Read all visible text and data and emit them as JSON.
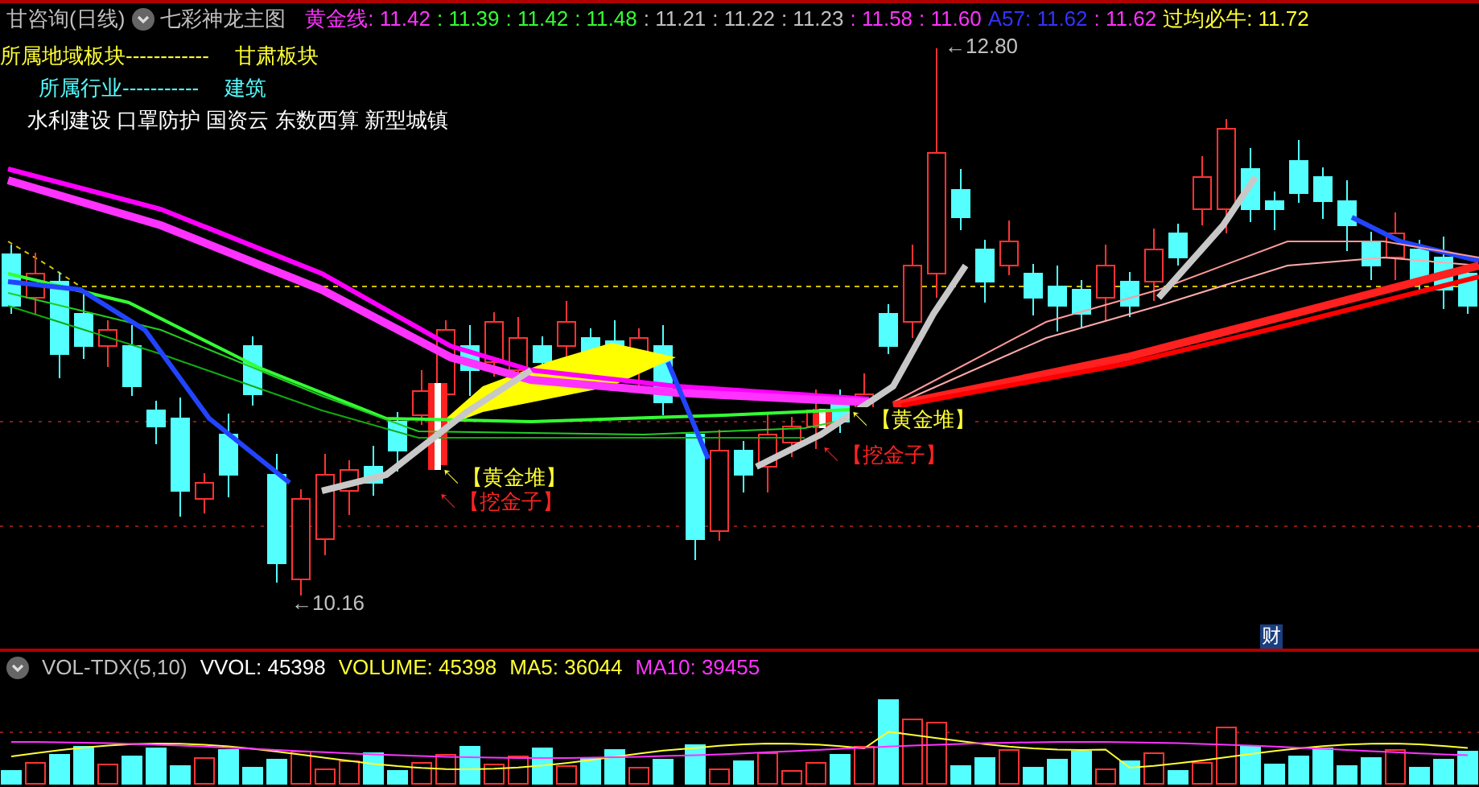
{
  "title": "甘咨询(日线)",
  "indicator": "七彩神龙主图",
  "legend": [
    {
      "text": "黄金线: 11.42",
      "color": "#ff33ff"
    },
    {
      "text": ": 11.39",
      "color": "#33ff33"
    },
    {
      "text": ": 11.42",
      "color": "#33ff33"
    },
    {
      "text": ": 11.48",
      "color": "#33ff33"
    },
    {
      "text": ": 11.21",
      "color": "#c0c0c0"
    },
    {
      "text": ": 11.22",
      "color": "#c0c0c0"
    },
    {
      "text": ": 11.23",
      "color": "#c0c0c0"
    },
    {
      "text": ": 11.58",
      "color": "#ff33ff"
    },
    {
      "text": ": 11.60",
      "color": "#ff33ff"
    },
    {
      "text": "A57: 11.62",
      "color": "#3333ff"
    },
    {
      "text": ": 11.62",
      "color": "#ff33ff"
    },
    {
      "text": "过均必牛: 11.72",
      "color": "#ffff33"
    }
  ],
  "sector": {
    "label": "所属地域板块------------",
    "value": "甘肃板块"
  },
  "industry": {
    "label": "所属行业-----------",
    "value": "建筑"
  },
  "concepts": "水利建设 口罩防护 国资云 东数西算 新型城镇",
  "price_marks": [
    {
      "text": "←12.80",
      "kind": "high"
    },
    {
      "text": "←10.16",
      "kind": "low"
    }
  ],
  "annotations": [
    {
      "text": "↖【黄金堆】",
      "kind": "gold"
    },
    {
      "text": "↖【挖金子】",
      "kind": "dig"
    },
    {
      "text": "↖【黄金堆】",
      "kind": "gold"
    },
    {
      "text": "↖【挖金子】",
      "kind": "dig"
    }
  ],
  "badge": "财",
  "volume": {
    "name": "VOL-TDX(5,10)",
    "legend": [
      {
        "text": "VVOL: 45398",
        "color": "#ffffff"
      },
      {
        "text": "VOLUME: 45398",
        "color": "#ffff33"
      },
      {
        "text": "MA5: 36044",
        "color": "#ffff33"
      },
      {
        "text": "MA10: 39455",
        "color": "#ff33ff"
      }
    ]
  }
}
